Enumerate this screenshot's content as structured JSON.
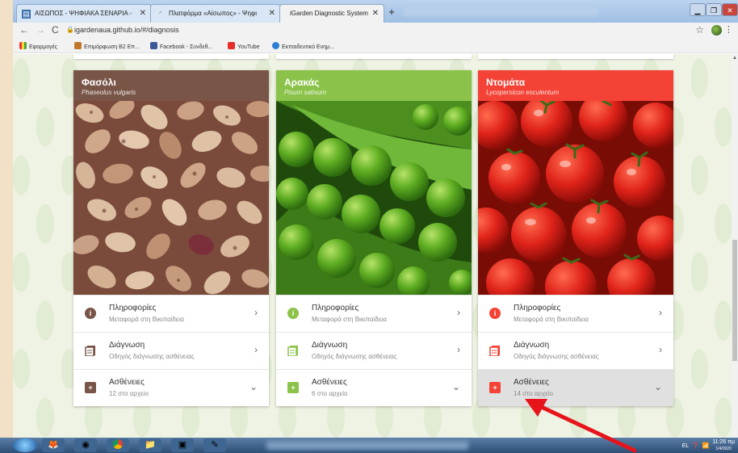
{
  "browser": {
    "tabs": [
      {
        "label": "ΑΙΣΩΠΟΣ - ΨΗΦΙΑΚΑ ΣΕΝΑΡΙΑ -",
        "icon": "page-icon"
      },
      {
        "label": "Πλατφόρμα «Αίσωπος» - Ψηφι",
        "icon": "aisopos-icon"
      },
      {
        "label": "iGarden Diagnostic System",
        "icon": "none"
      }
    ],
    "url": "igardenaua.github.io/#/diagnosis",
    "bookmarks": [
      {
        "label": "Εφαρμογές",
        "icon": "apps-icon"
      },
      {
        "label": "Επιμόρφωση Β2 Επ...",
        "icon": "bookmark-icon"
      },
      {
        "label": "Facebook - Συνδεθ...",
        "icon": "facebook-icon"
      },
      {
        "label": "YouTube",
        "icon": "youtube-icon"
      },
      {
        "label": "Εκπαιδευτικό Ενημ...",
        "icon": "globe-icon"
      }
    ]
  },
  "cards": [
    {
      "title": "Φασόλι",
      "subtitle": "Phaseolus vulgaris",
      "header_color": "#795548",
      "rows": [
        {
          "title": "Πληροφορίες",
          "subtitle": "Μεταφορά στη Βικιπαίδεια",
          "icon": "info-icon",
          "chevron": "›"
        },
        {
          "title": "Διάγνωση",
          "subtitle": "Οδηγός διάγνωσης ασθένειας",
          "icon": "document-icon",
          "chevron": "›"
        },
        {
          "title": "Ασθένειες",
          "subtitle": "12 στο αρχείο",
          "icon": "plus-icon",
          "chevron": "⌄"
        }
      ]
    },
    {
      "title": "Αρακάς",
      "subtitle": "Pisum sativum",
      "header_color": "#8bc34a",
      "rows": [
        {
          "title": "Πληροφορίες",
          "subtitle": "Μεταφορά στη Βικιπαίδεια",
          "icon": "info-icon",
          "chevron": "›"
        },
        {
          "title": "Διάγνωση",
          "subtitle": "Οδηγός διάγνωσης ασθένειας",
          "icon": "document-icon",
          "chevron": "›"
        },
        {
          "title": "Ασθένειες",
          "subtitle": "6 στο αρχείο",
          "icon": "plus-icon",
          "chevron": "⌄"
        }
      ]
    },
    {
      "title": "Ντομάτα",
      "subtitle": "Lycopersicon esculentum",
      "header_color": "#f44336",
      "rows": [
        {
          "title": "Πληροφορίες",
          "subtitle": "Μεταφορά στη Βικιπαίδεια",
          "icon": "info-icon",
          "chevron": "›"
        },
        {
          "title": "Διάγνωση",
          "subtitle": "Οδηγός διάγνωσης ασθένειας",
          "icon": "document-icon",
          "chevron": "›"
        },
        {
          "title": "Ασθένειες",
          "subtitle": "14 στο αρχείο",
          "icon": "plus-icon",
          "chevron": "⌄"
        }
      ]
    }
  ],
  "taskbar": {
    "lang": "EL",
    "time": "11:26 πμ",
    "date": "1/4/2020"
  },
  "colors": {
    "annotation_arrow": "#e8141b",
    "highlight_row": "#e0e0e0"
  }
}
